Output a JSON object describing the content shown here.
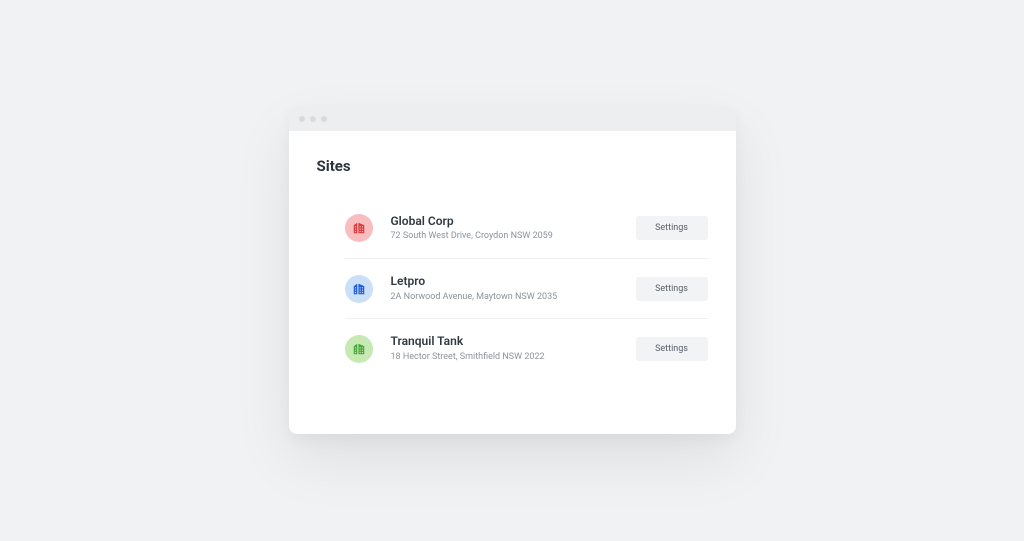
{
  "heading": "Sites",
  "settings_label": "Settings",
  "sites": [
    {
      "name": "Global Corp",
      "address": "72 South West Drive, Croydon NSW 2059",
      "icon": "building-icon",
      "avatar_bg": "#f7bdbf",
      "icon_color": "#d63d3d"
    },
    {
      "name": "Letpro",
      "address": "2A Norwood Avenue, Maytown NSW 2035",
      "icon": "building-icon",
      "avatar_bg": "#c9e0f7",
      "icon_color": "#1f5bd6"
    },
    {
      "name": "Tranquil Tank",
      "address": "18 Hector Street, Smithfield NSW 2022",
      "icon": "building-icon",
      "avatar_bg": "#c7e9b4",
      "icon_color": "#49a63b"
    }
  ]
}
